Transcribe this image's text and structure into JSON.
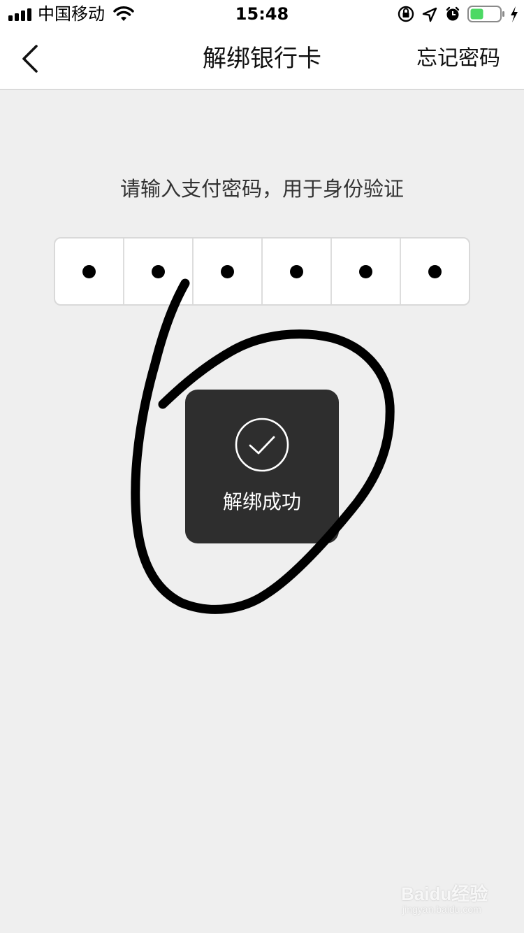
{
  "status_bar": {
    "carrier": "中国移动",
    "time": "15:48",
    "battery_color": "#4cd964"
  },
  "nav": {
    "title": "解绑银行卡",
    "right_action": "忘记密码",
    "back_icon": "chevron-left-icon"
  },
  "prompt": "请输入支付密码，用于身份验证",
  "password": {
    "length": 6,
    "filled": 6,
    "digits": [
      "•",
      "•",
      "•",
      "•",
      "•",
      "•"
    ]
  },
  "toast": {
    "icon": "check-circle-icon",
    "message": "解绑成功"
  },
  "watermark": {
    "logo": "Baidu经验",
    "url": "jingyan.baidu.com"
  },
  "colors": {
    "background": "#efefef",
    "toast_background": "#2e2e2e",
    "annotation": "#000000"
  }
}
